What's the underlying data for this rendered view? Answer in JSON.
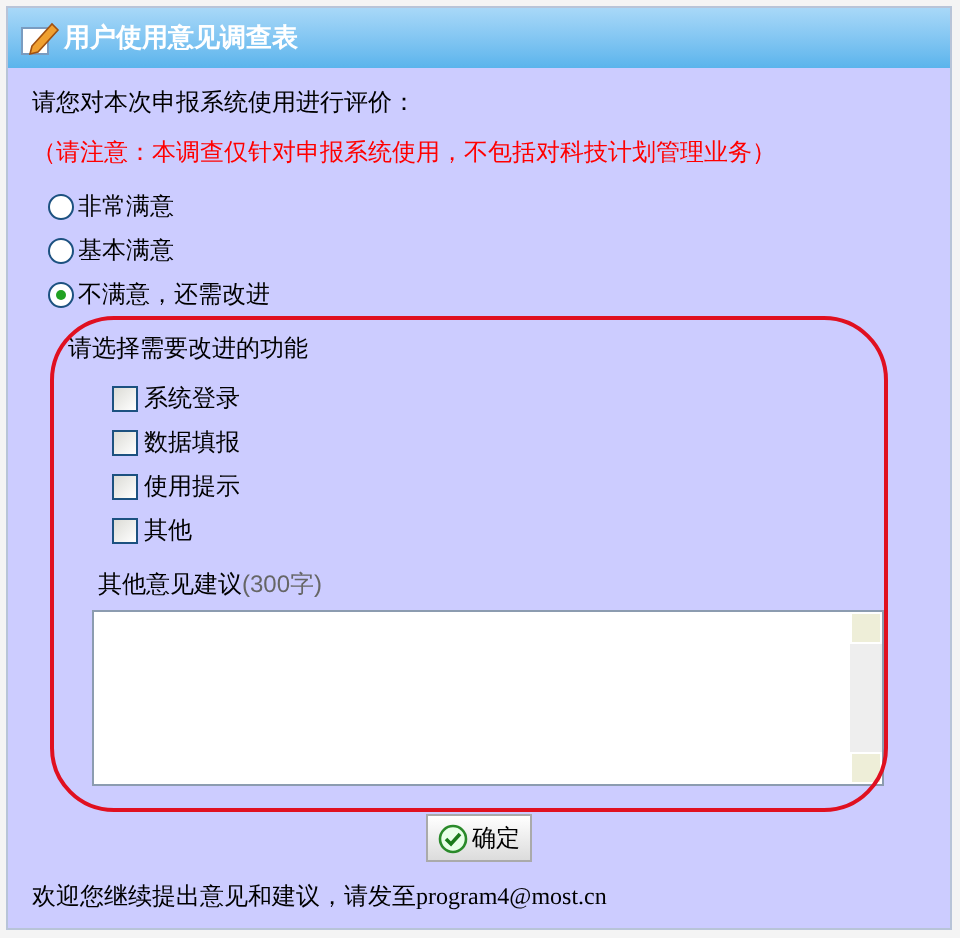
{
  "window": {
    "title": "用户使用意见调查表"
  },
  "intro": "请您对本次申报系统使用进行评价：",
  "notice": "（请注意：本调查仅针对申报系统使用，不包括对科技计划管理业务）",
  "ratings": [
    {
      "label": "非常满意",
      "selected": false
    },
    {
      "label": "基本满意",
      "selected": false
    },
    {
      "label": "不满意，还需改进",
      "selected": true
    }
  ],
  "features_prompt": "请选择需要改进的功能",
  "features": [
    {
      "label": "系统登录",
      "checked": false
    },
    {
      "label": "数据填报",
      "checked": false
    },
    {
      "label": "使用提示",
      "checked": false
    },
    {
      "label": "其他",
      "checked": false
    }
  ],
  "comments": {
    "label": "其他意见建议",
    "limit": "(300字)"
  },
  "confirm_button": "确定",
  "footer": {
    "text": "欢迎您继续提出意见和建议，请发至",
    "email": "program4@most.cn"
  }
}
